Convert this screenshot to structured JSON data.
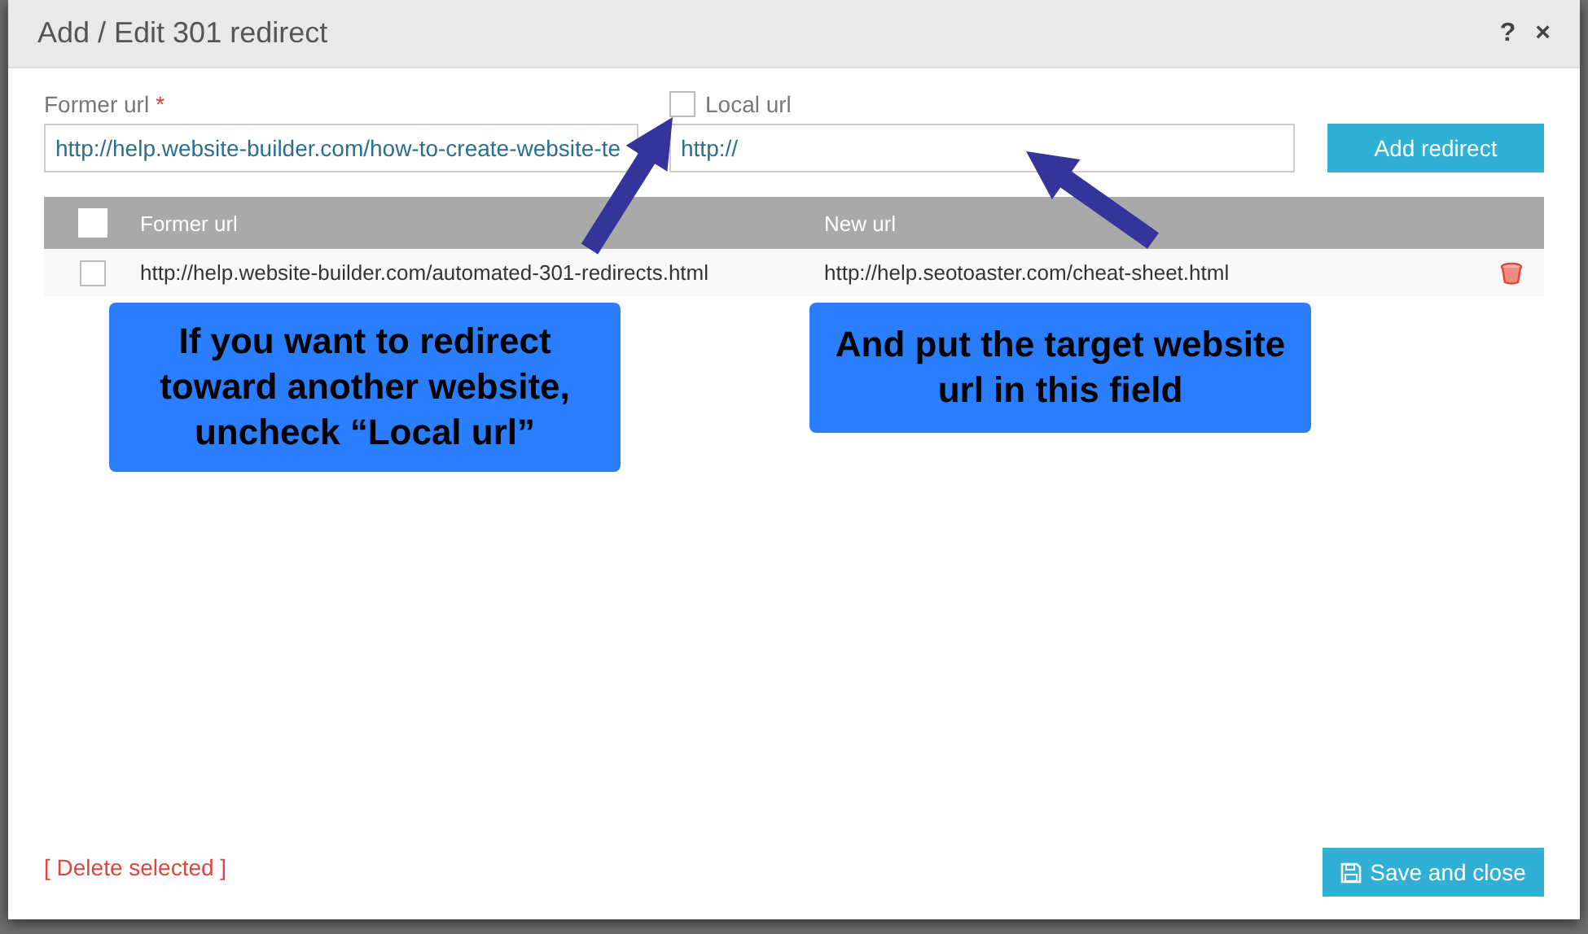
{
  "dialog": {
    "title": "Add / Edit 301 redirect",
    "help": "?",
    "close": "×"
  },
  "form": {
    "former_url": {
      "label": "Former url",
      "required_mark": "*",
      "value": "http://help.website-builder.com/how-to-create-website-te"
    },
    "local_url": {
      "label": "Local url",
      "checked": false
    },
    "new_url": {
      "value": "http://"
    },
    "add_button": "Add redirect"
  },
  "table": {
    "select_all_checked": false,
    "columns": [
      "Former url",
      "New url"
    ],
    "rows": [
      {
        "checked": false,
        "former_url": "http://help.website-builder.com/automated-301-redirects.html",
        "new_url": "http://help.seotoaster.com/cheat-sheet.html"
      }
    ]
  },
  "delete_selected": "[ Delete selected ]",
  "save_button": "Save and close",
  "callouts": [
    {
      "text": "If you want to redirect toward another website, uncheck “Local url”"
    },
    {
      "text": "And put the target website url in this field"
    }
  ]
}
